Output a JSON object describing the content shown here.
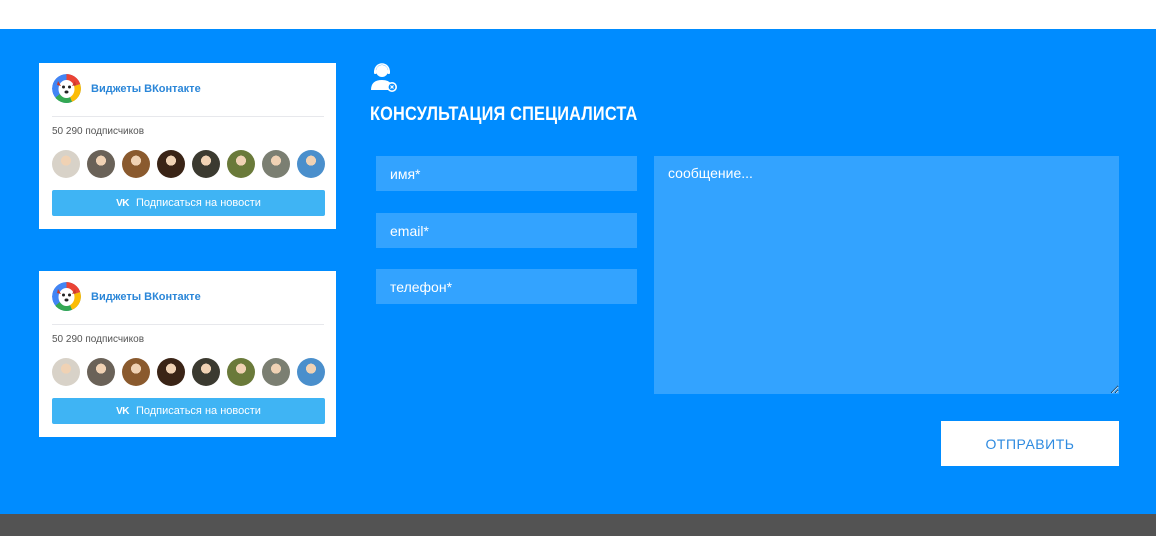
{
  "vk_widgets": [
    {
      "title": "Виджеты ВКонтакте",
      "subscribers": "50 290 подписчиков",
      "subscribe_label": "Подписаться на новости",
      "vk_mark": "VK"
    },
    {
      "title": "Виджеты ВКонтакте",
      "subscribers": "50 290 подписчиков",
      "subscribe_label": "Подписаться на новости",
      "vk_mark": "VK"
    }
  ],
  "avatar_colors": [
    "#d8d2c8",
    "#6a6258",
    "#8a5a2e",
    "#3a2416",
    "#3b3a30",
    "#6a7a3a",
    "#7b7f72",
    "#4a8fcc"
  ],
  "consultation": {
    "icon": "support-agent-icon",
    "title": "КОНСУЛЬТАЦИЯ СПЕЦИАЛИСТА"
  },
  "form": {
    "name_placeholder": "имя*",
    "email_placeholder": "email*",
    "phone_placeholder": "телефон*",
    "message_placeholder": "сообщение...",
    "submit_label": "ОТПРАВИТЬ"
  },
  "colors": {
    "main_bg": "#008cff",
    "field_bg": "#33a3ff",
    "vk_button": "#3fb4f4",
    "footer_bg": "#535353"
  }
}
